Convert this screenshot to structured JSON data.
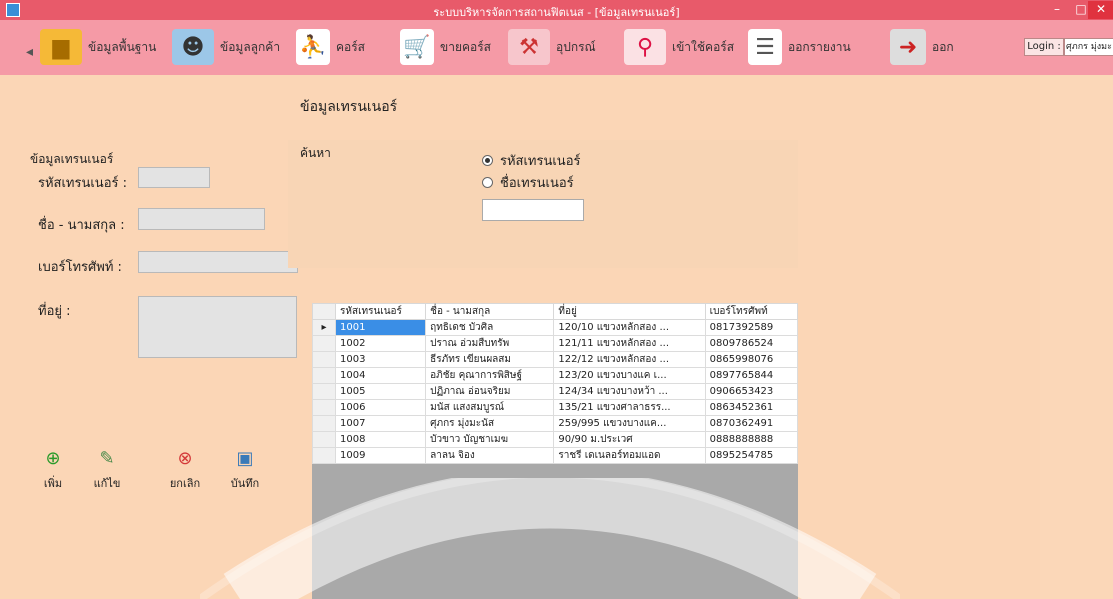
{
  "window": {
    "title": "ระบบบริหารจัดการสถานฟิตเนส - [ข้อมูลเทรนเนอร์]",
    "minimize": "–",
    "maximize": "□",
    "close": "✕"
  },
  "menu": [
    {
      "label": "ข้อมูลพื้นฐาน",
      "icon": "folder-icon"
    },
    {
      "label": "ข้อมูลลูกค้า",
      "icon": "users-icon"
    },
    {
      "label": "คอร์ส",
      "icon": "treadmill-icon"
    },
    {
      "label": "ขายคอร์ส",
      "icon": "cart-icon"
    },
    {
      "label": "อุปกรณ์",
      "icon": "dumbbell-icon"
    },
    {
      "label": "เข้าใช้คอร์ส",
      "icon": "location-pin-icon"
    },
    {
      "label": "ออกรายงาน",
      "icon": "report-icon"
    },
    {
      "label": "ออก",
      "icon": "exit-door-icon"
    }
  ],
  "login": {
    "button": "Login :",
    "user": "ศุภกร มุ่งมะนัส",
    "mdi_controls": "_ ♬"
  },
  "form": {
    "title": "ข้อมูลเทรนเนอร์",
    "group_label": "ข้อมูลเทรนเนอร์",
    "id_label": "รหัสเทรนเนอร์ :",
    "name_label": "ชื่อ - นามสกุล :",
    "phone_label": "เบอร์โทรศัพท์ :",
    "address_label": "ที่อยู่ :",
    "id_value": "",
    "name_value": "",
    "phone_value": "",
    "address_value": ""
  },
  "search": {
    "label": "ค้นหา",
    "option_id": "รหัสเทรนเนอร์",
    "option_name": "ชื่อเทรนเนอร์",
    "selected": "id",
    "query": ""
  },
  "grid": {
    "columns": [
      "รหัสเทรนเนอร์",
      "ชื่อ - นามสกุล",
      "ที่อยู่",
      "เบอร์โทรศัพท์"
    ],
    "rows": [
      [
        "1001",
        "ฤทธิเดช บัวศิล",
        "120/10 แขวงหลักสอง ...",
        "0817392589"
      ],
      [
        "1002",
        "ปราณ อ่วมสืบทรัพ",
        "121/11 แขวงหลักสอง ...",
        "0809786524"
      ],
      [
        "1003",
        "ธีรภัทร เขียนผลสม",
        "122/12 แขวงหลักสอง ...",
        "0865998076"
      ],
      [
        "1004",
        "อภิชัย คุณาการพิสิษฐ์",
        "123/20 แขวงบางแค เ...",
        "0897765844"
      ],
      [
        "1005",
        "ปฏิภาณ อ่อนจริยม",
        "124/34 แขวงบางหว้า ...",
        "0906653423"
      ],
      [
        "1006",
        "มนัส แสงสมบูรณ์",
        "135/21 แขวงศาลาธรร...",
        "0863452361"
      ],
      [
        "1007",
        "ศุภกร มุ่งมะนัส",
        "259/995 แขวงบางแค...",
        "0870362491"
      ],
      [
        "1008",
        "บัวขาว บัญชาเมฆ",
        "90/90 ม.ประเวศ",
        "0888888888"
      ],
      [
        "1009",
        "ลาลน จิอง",
        "ราชรี เดเนลอร์ทอมแอด",
        "0895254785"
      ]
    ]
  },
  "actions": {
    "add": "เพิ่ม",
    "edit": "แก้ไข",
    "cancel": "ยกเลิก",
    "save": "บันทึก"
  }
}
